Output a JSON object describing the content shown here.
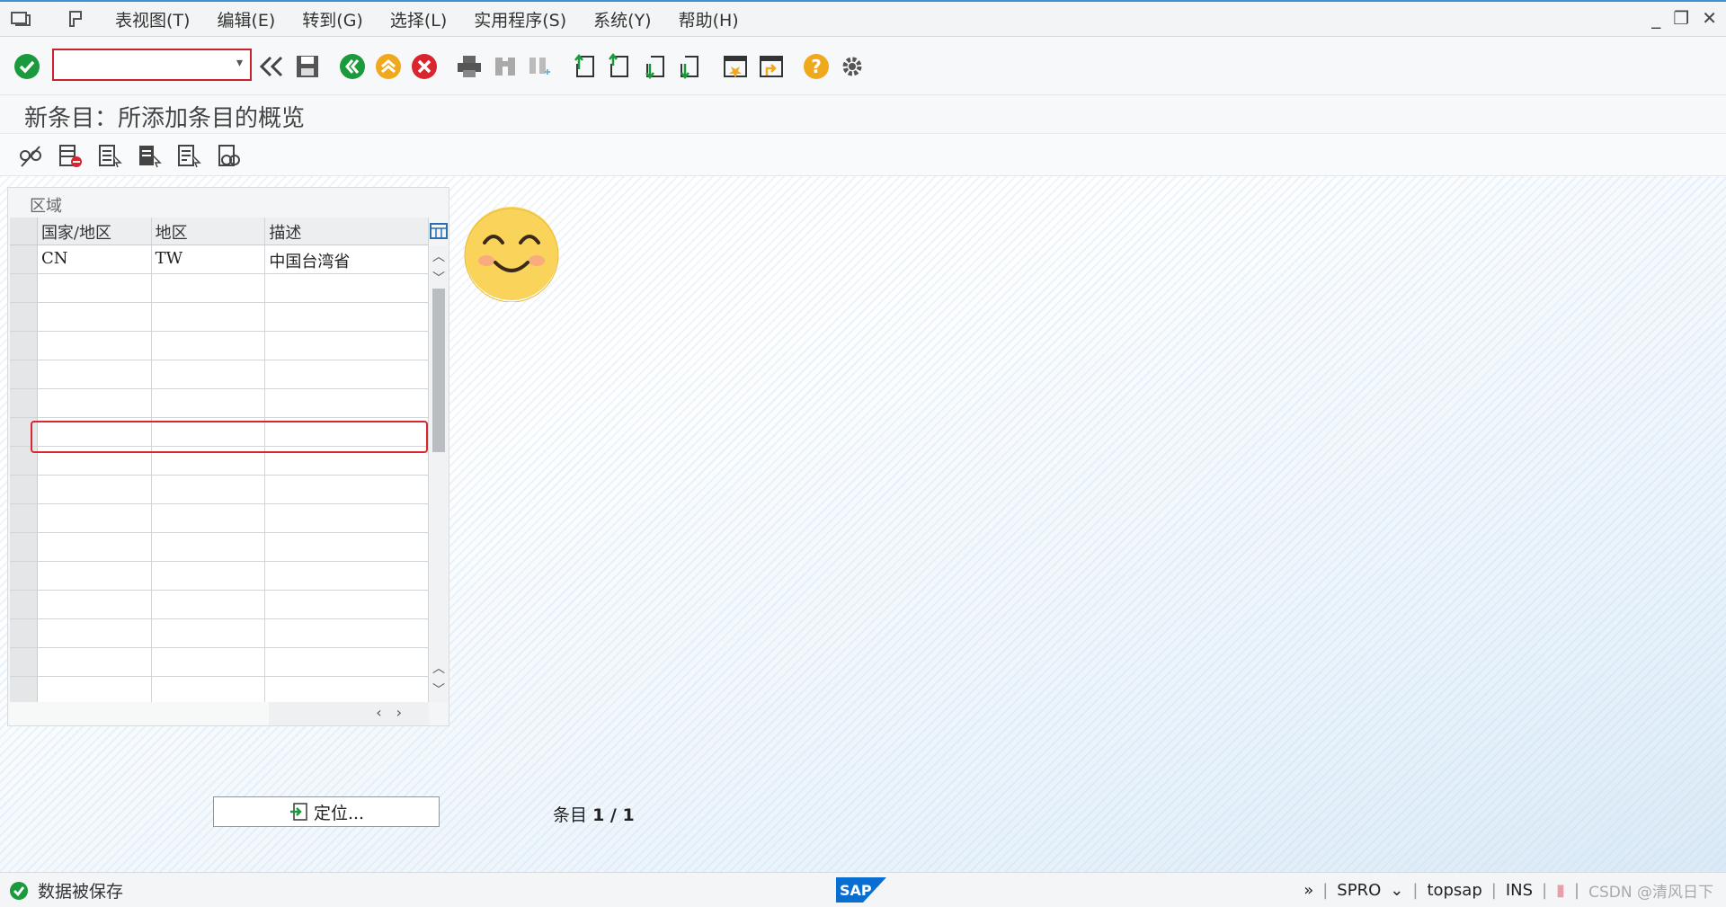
{
  "menu": {
    "items": [
      "表视图(T)",
      "编辑(E)",
      "转到(G)",
      "选择(L)",
      "实用程序(S)",
      "系统(Y)",
      "帮助(H)"
    ]
  },
  "toolbar": {
    "command_value": "",
    "icons": [
      "check-icon",
      "back-icon",
      "save-icon",
      "exit-icon",
      "cancel-icon",
      "print-icon",
      "find-icon",
      "find-next-icon",
      "first-page-icon",
      "prev-page-icon",
      "next-page-icon",
      "last-page-icon",
      "new-session-icon",
      "shortcut-icon",
      "help-icon",
      "settings-icon"
    ]
  },
  "title": "新条目：所添加条目的概览",
  "group_title": "区域",
  "table": {
    "columns": [
      "国家/地区",
      "地区",
      "描述"
    ],
    "rows": [
      [
        "CN",
        "TW",
        "中国台湾省"
      ]
    ]
  },
  "locate_button": "定位...",
  "entry": {
    "label": "条目",
    "value": "1 / 1"
  },
  "status": {
    "message": "数据被保存",
    "transaction": "SPRO",
    "system": "topsap",
    "mode": "INS",
    "watermark": "CSDN @清风日下"
  },
  "colors": {
    "accent_red": "#d9262e",
    "success_green": "#1a9a3c",
    "brand_blue": "#0a6ed1"
  }
}
